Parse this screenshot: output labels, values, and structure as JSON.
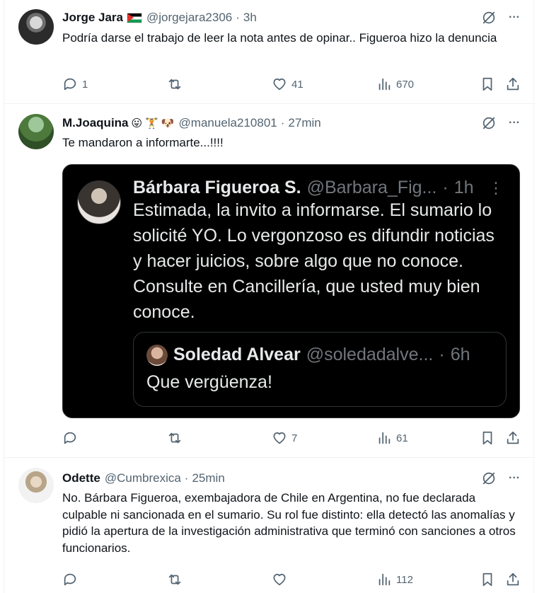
{
  "tweets": [
    {
      "name": "Jorge Jara",
      "handle": "@jorgejara2306",
      "time": "3h",
      "text": "Podría darse el trabajo de leer la nota antes de opinar.. Figueroa hizo la denuncia",
      "replies": "1",
      "retweets": "",
      "likes": "41",
      "views": "670"
    },
    {
      "name": "M.Joaquina",
      "emojis": [
        "😛",
        "🏋",
        "🐶"
      ],
      "handle": "@manuela210801",
      "time": "27min",
      "text": "Te mandaron a informarte...!!!!",
      "replies": "",
      "retweets": "",
      "likes": "7",
      "views": "61",
      "embed": {
        "name": "Bárbara Figueroa S.",
        "handle": "@Barbara_Fig...",
        "time": "1h",
        "more": "⋮",
        "text": "Estimada, la invito a informarse. El sumario lo solicité YO. Lo vergonzoso es difundir noticias y hacer juicios, sobre algo que no conoce. Consulte en Cancillería, que usted muy bien conoce.",
        "quote": {
          "name": "Soledad Alvear",
          "handle": "@soledadalve...",
          "time": "6h",
          "text": "Que vergüenza!"
        }
      }
    },
    {
      "name": "Odette",
      "handle": "@Cumbrexica",
      "time": "25min",
      "text": "No. Bárbara Figueroa, exembajadora de Chile en Argentina, no fue declarada culpable ni sancionada en el sumario. Su rol fue distinto: ella detectó las anomalías y pidió la apertura de la investigación administrativa que terminó con sanciones a otros funcionarios.",
      "replies": "",
      "retweets": "",
      "likes": "",
      "views": "112"
    }
  ],
  "separator": "·",
  "more_glyph": "···",
  "colors": {
    "text": "#0f1419",
    "secondary": "#536471",
    "border": "#eff3f4",
    "embed_bg": "#000000"
  }
}
